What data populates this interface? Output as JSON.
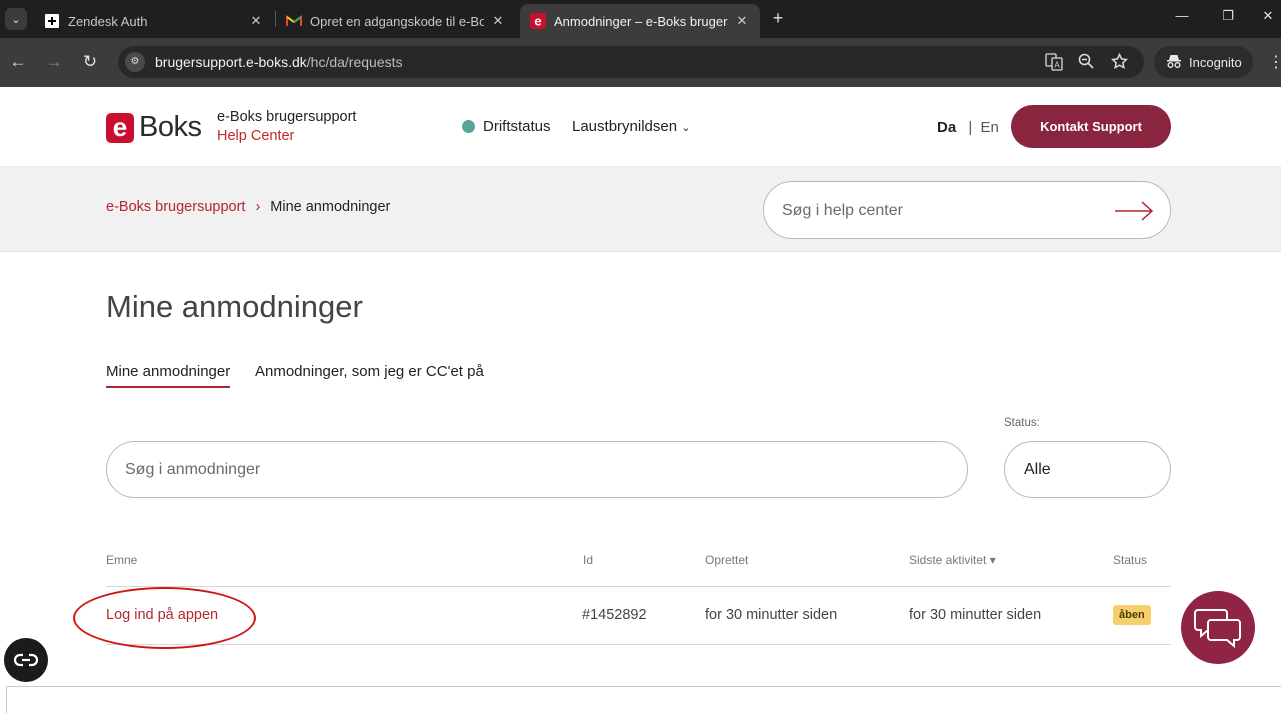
{
  "browser": {
    "tabs": [
      {
        "title": "Zendesk Auth",
        "active": false
      },
      {
        "title": "Opret en adgangskode til e-Boks",
        "active": false
      },
      {
        "title": "Anmodninger – e-Boks brugersupport",
        "active": true
      }
    ],
    "url_host": "brugersupport.e-boks.dk",
    "url_path": "/hc/da/requests",
    "incognito_label": "Incognito"
  },
  "header": {
    "logo_letter": "e",
    "logo_word": "Boks",
    "brand_line1": "e-Boks brugersupport",
    "brand_line2": "Help Center",
    "driftstatus": "Driftstatus",
    "user_name": "Laustbrynildsen",
    "lang_da": "Da",
    "lang_sep": "|",
    "lang_en": "En",
    "contact_button": "Kontakt Support"
  },
  "breadcrumb": {
    "home": "e-Boks brugersupport",
    "separator": "›",
    "current": "Mine anmodninger"
  },
  "hc_search": {
    "placeholder": "Søg i help center"
  },
  "main": {
    "title": "Mine anmodninger",
    "tabs": [
      {
        "label": "Mine anmodninger",
        "active": true
      },
      {
        "label": "Anmodninger, som jeg er CC'et på",
        "active": false
      }
    ],
    "search_placeholder": "Søg i anmodninger",
    "status_label": "Status:",
    "status_value": "Alle"
  },
  "table": {
    "headers": {
      "subject": "Emne",
      "id": "Id",
      "created": "Oprettet",
      "last_activity": "Sidste aktivitet ▾",
      "status": "Status"
    },
    "rows": [
      {
        "subject": "Log ind på appen",
        "id": "#1452892",
        "created": "for 30 minutter siden",
        "last_activity": "for 30 minutter siden",
        "status": "åben"
      }
    ]
  },
  "colors": {
    "brand_red": "#c8102e",
    "link_red": "#b3262f",
    "button_maroon": "#8a2540",
    "status_green": "#5aa59a",
    "badge_yellow": "#f6d06b"
  }
}
